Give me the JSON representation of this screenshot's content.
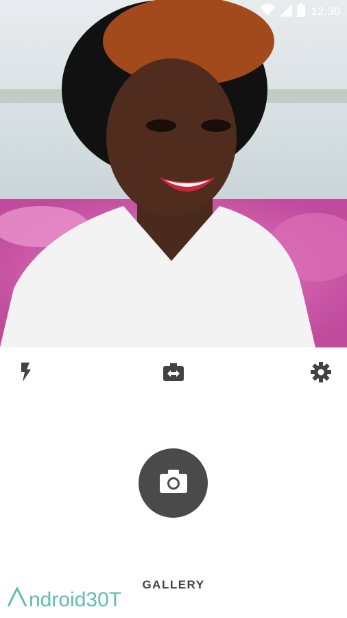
{
  "status_bar": {
    "time": "12:30",
    "icons": [
      "wifi-icon",
      "signal-icon",
      "battery-icon"
    ]
  },
  "preview": {
    "description_icon": "camera-preview"
  },
  "toolbar": {
    "flash_icon": "flash-icon",
    "switch_icon": "switch-camera-icon",
    "settings_icon": "settings-icon"
  },
  "shutter": {
    "icon": "camera-icon"
  },
  "gallery": {
    "label": "GALLERY"
  },
  "watermark": {
    "text": "ndroid30T"
  },
  "colors": {
    "shutter_bg": "#4a4a4a",
    "icon": "#424242",
    "watermark": "#4db6ac"
  }
}
